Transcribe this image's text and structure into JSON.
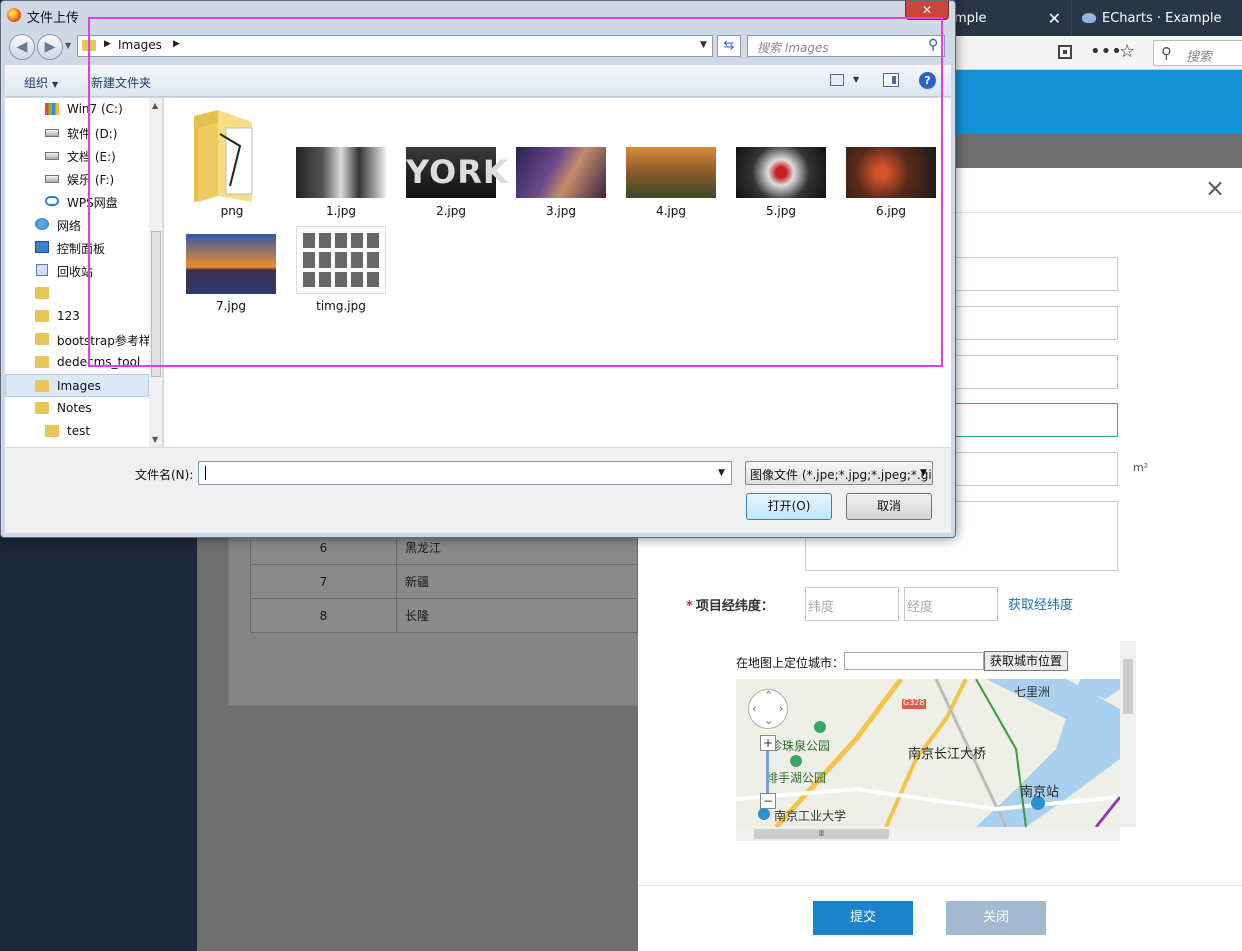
{
  "browser": {
    "tabs": [
      {
        "label": "ample",
        "close": "✕"
      },
      {
        "label": "ECharts · Example",
        "close": "✕"
      }
    ],
    "search_placeholder": "搜索",
    "icons": {
      "qr": "qr-code-icon",
      "more": "more-dots-icon",
      "bookmark": "star-icon",
      "search": "search-icon"
    }
  },
  "background_table": {
    "rows": [
      {
        "id": "6",
        "province": "黑龙江"
      },
      {
        "id": "7",
        "province": "新疆"
      },
      {
        "id": "8",
        "province": "长隆"
      }
    ]
  },
  "modal": {
    "close": "×",
    "area_unit": "m²",
    "coord_label": "项目经纬度：",
    "required_mark": "*",
    "latitude_placeholder": "纬度",
    "longitude_placeholder": "经度",
    "get_coord_link": "获取经纬度",
    "map": {
      "city_label": "在地图上定位城市：",
      "city_button": "获取城市位置",
      "places": [
        "七里洲",
        "G328",
        "珍珠泉公园",
        "南京长江大桥",
        "绯手湖公园",
        "南京站",
        "南京工业大学"
      ],
      "zoom_in": "+",
      "zoom_out": "−",
      "hscroll_grip": "Ⅲ"
    },
    "submit_button": "提交",
    "close_button": "关闭"
  },
  "dialog": {
    "title": "文件上传",
    "close": "✕",
    "back": "◀",
    "forward": "▶",
    "address": {
      "current": "Images"
    },
    "search_placeholder": "搜索 Images",
    "toolbar": {
      "organize": "组织",
      "new_folder": "新建文件夹",
      "help": "?"
    },
    "nav_items": [
      {
        "label": "Win7 (C:)",
        "icon": "windows-drive-icon"
      },
      {
        "label": "软件 (D:)",
        "icon": "drive-icon"
      },
      {
        "label": "文档 (E:)",
        "icon": "drive-icon"
      },
      {
        "label": "娱乐 (F:)",
        "icon": "drive-icon"
      },
      {
        "label": "WPS网盘",
        "icon": "cloud-icon"
      },
      {
        "label": "网络",
        "icon": "network-icon"
      },
      {
        "label": "控制面板",
        "icon": "control-panel-icon"
      },
      {
        "label": "回收站",
        "icon": "recycle-bin-icon"
      },
      {
        "label": "",
        "icon": "folder-icon"
      },
      {
        "label": "123",
        "icon": "folder-icon"
      },
      {
        "label": "bootstrap参考样",
        "icon": "folder-icon"
      },
      {
        "label": "dedecms_tool",
        "icon": "folder-icon"
      },
      {
        "label": "Images",
        "icon": "folder-icon",
        "selected": true
      },
      {
        "label": "Notes",
        "icon": "folder-icon"
      },
      {
        "label": "test",
        "icon": "folder-icon"
      }
    ],
    "files": [
      {
        "name": "png",
        "type": "folder"
      },
      {
        "name": "1.jpg",
        "type": "image"
      },
      {
        "name": "2.jpg",
        "type": "image",
        "overlay": "YORK"
      },
      {
        "name": "3.jpg",
        "type": "image"
      },
      {
        "name": "4.jpg",
        "type": "image"
      },
      {
        "name": "5.jpg",
        "type": "image"
      },
      {
        "name": "6.jpg",
        "type": "image"
      },
      {
        "name": "7.jpg",
        "type": "image"
      },
      {
        "name": "timg.jpg",
        "type": "image"
      }
    ],
    "filename_label": "文件名(N):",
    "filename_value": "",
    "filetype_value": "图像文件 (*.jpe;*.jpg;*.jpeg;*.gif",
    "open_button": "打开(O)",
    "cancel_button": "取消"
  },
  "colors": {
    "highlight": "#e83be3",
    "primary": "#1b82cc",
    "header": "#1490d6"
  }
}
